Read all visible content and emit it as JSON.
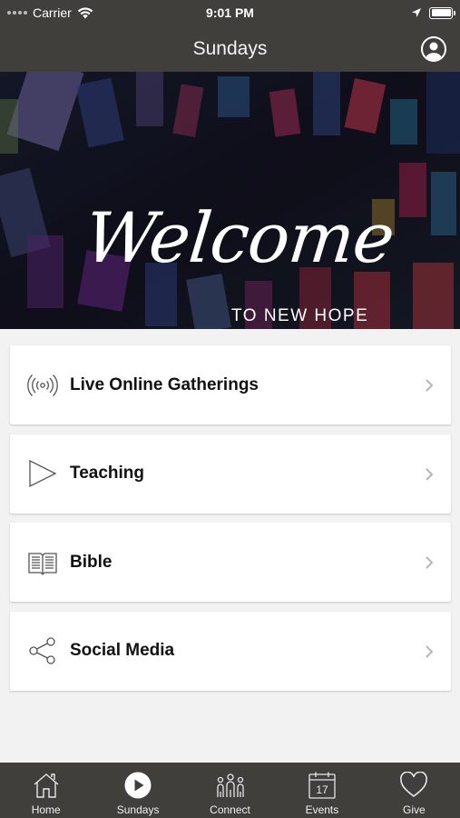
{
  "status_bar": {
    "carrier": "Carrier",
    "time": "9:01 PM"
  },
  "nav": {
    "title": "Sundays"
  },
  "hero": {
    "headline": "Welcome",
    "subtitle": "TO NEW HOPE"
  },
  "menu": {
    "items": [
      {
        "label": "Live Online Gatherings",
        "icon": "broadcast-icon"
      },
      {
        "label": "Teaching",
        "icon": "play-outline-icon"
      },
      {
        "label": "Bible",
        "icon": "book-icon"
      },
      {
        "label": "Social Media",
        "icon": "share-icon"
      }
    ]
  },
  "tabs": {
    "items": [
      {
        "label": "Home",
        "icon": "home-icon"
      },
      {
        "label": "Sundays",
        "icon": "play-circle-icon",
        "selected": true
      },
      {
        "label": "Connect",
        "icon": "people-icon"
      },
      {
        "label": "Events",
        "icon": "calendar-icon",
        "calendar_day": "17"
      },
      {
        "label": "Give",
        "icon": "heart-icon"
      }
    ]
  },
  "colors": {
    "bar_background": "#413f3c",
    "page_background": "#f2f2f2"
  }
}
